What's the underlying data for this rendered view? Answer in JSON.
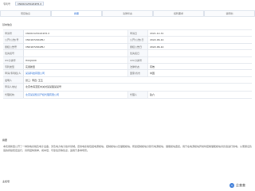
{
  "header": {
    "label": "专利号",
    "patent_number": "CN202125424155.0"
  },
  "tabs": [
    {
      "label": "项目信息"
    },
    {
      "label": "摘要"
    },
    {
      "label": "法律状态"
    },
    {
      "label": "权利要求"
    },
    {
      "label": "说明书"
    }
  ],
  "sections": {
    "basic": "基本信息",
    "abstract": "摘要",
    "claims": "主权项"
  },
  "info": {
    "application_no_label": "申请号",
    "application_no": "CN202125424155.0",
    "application_date_label": "申请日",
    "application_date": "2021-12-31",
    "pub_no_label": "公开(公告)号",
    "pub_no": "CN216729428U",
    "pub_date_label": "公开(公告)日",
    "pub_date": "2022-06-14",
    "grant_no_label": "授权公告号",
    "grant_no": "CN216729428U",
    "grant_date_label": "授权公告日",
    "grant_date": "2022-06-14",
    "priority_label": "优先权号",
    "priority": "",
    "priority_date_label": "优先权日",
    "priority_date": "",
    "ipc_label": "IPC分类号",
    "ipc": "H02J9/00",
    "cpc_label": "CPC分类号",
    "cpc": "",
    "patent_type_label": "专利类型",
    "patent_type": "实用新型",
    "status_label": "法律状态",
    "status": "有效",
    "applicant_label": "申请(专利权)人",
    "applicant": "某某科技有限公司",
    "country_label": "国家/省市",
    "country": "中国",
    "inventor_label": "发明人",
    "inventor": "张三; 李四; 王五",
    "address_label": "申请人地址",
    "address": "北京市海淀区中关村某某路某某号",
    "agency_label": "代理机构",
    "agency": "北京某某知识产权代理有限公司",
    "agent_label": "代理人",
    "agent": "赵六"
  },
  "abstract": "本实用新型公开了一种供电系统及电子设备，涉及电力电子技术领域。该供电系统包括电源模块、控制模块以及储能模块，所述控制模块分别与电源模块、储能模块连接，用于在电源模块异常时控制储能模块对负载进行供电，从而保证负载的持续稳定运行，具有结构简单、成本低、可靠性高等优点，适用于多种场景。",
  "logo": {
    "text": "企查查",
    "mark": "Q"
  },
  "colors": {
    "accent": "#2b6fd6",
    "border": "#e4e8ee"
  }
}
